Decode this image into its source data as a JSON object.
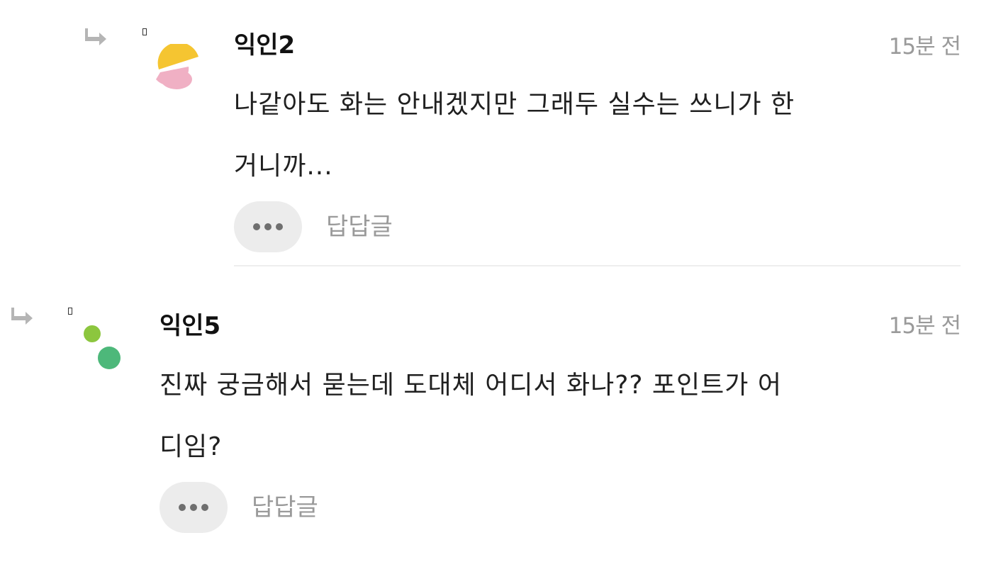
{
  "comments": [
    {
      "author": "익인2",
      "time": "15분 전",
      "body_line1": "나같아도 화는 안내겠지만 그래두 실수는 쓰니가 한",
      "body_line2": "거니까...",
      "reply_label": "답답글",
      "avatar_colors": [
        "#f5c531",
        "#f0b0c4"
      ]
    },
    {
      "author": "익인5",
      "time": "15분 전",
      "body_line1": "진짜 궁금해서 묻는데 도대체 어디서 화나?? 포인트가 어",
      "body_line2": "디임?",
      "reply_label": "답답글",
      "avatar_colors": [
        "#8cc63e",
        "#4db87a"
      ]
    }
  ],
  "colors": {
    "arrow": "#b5b5b5",
    "meta_text": "#9a9a9a",
    "button_bg": "#ececec",
    "divider": "#eeeeee"
  }
}
